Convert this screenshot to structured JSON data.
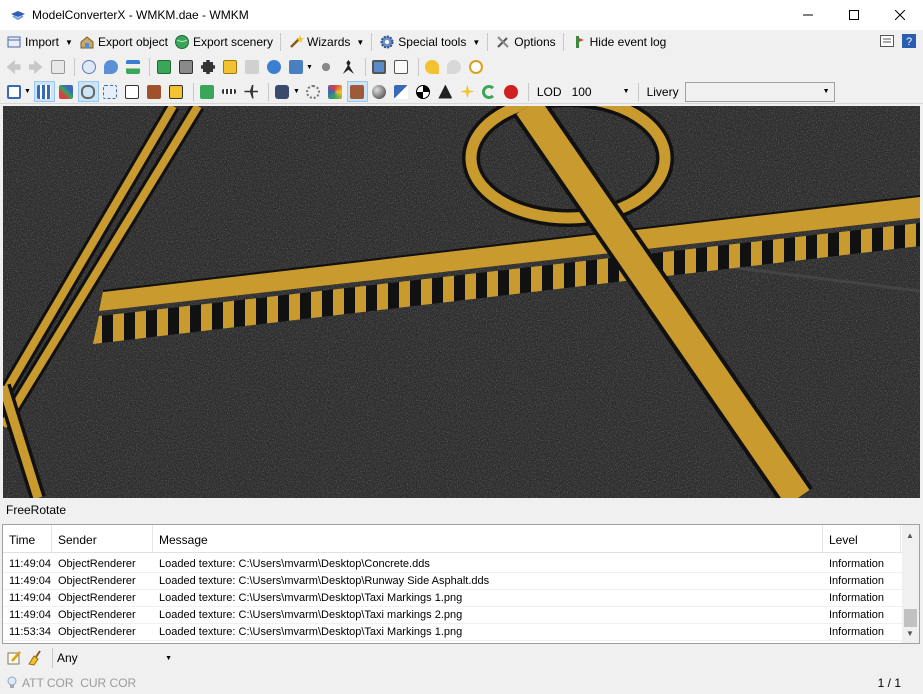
{
  "window": {
    "title": "ModelConverterX - WMKM.dae - WMKM"
  },
  "menu": {
    "import": "Import",
    "export_object": "Export object",
    "export_scenery": "Export scenery",
    "wizards": "Wizards",
    "special_tools": "Special tools",
    "options": "Options",
    "hide_event_log": "Hide event log"
  },
  "toolbar2": {
    "lod_label": "LOD",
    "lod_value": "100",
    "livery_label": "Livery",
    "livery_value": ""
  },
  "viewport": {
    "mode": "FreeRotate"
  },
  "log": {
    "columns": {
      "time": "Time",
      "sender": "Sender",
      "message": "Message",
      "level": "Level"
    },
    "rows": [
      {
        "time": "11:49:04",
        "sender": "ObjectRenderer",
        "message": "Loaded texture: C:\\Users\\mvarm\\Desktop\\Concrete.dds",
        "level": "Information"
      },
      {
        "time": "11:49:04",
        "sender": "ObjectRenderer",
        "message": "Loaded texture: C:\\Users\\mvarm\\Desktop\\Runway Side Asphalt.dds",
        "level": "Information"
      },
      {
        "time": "11:49:04",
        "sender": "ObjectRenderer",
        "message": "Loaded texture: C:\\Users\\mvarm\\Desktop\\Taxi Markings 1.png",
        "level": "Information"
      },
      {
        "time": "11:49:04",
        "sender": "ObjectRenderer",
        "message": "Loaded texture: C:\\Users\\mvarm\\Desktop\\Taxi markings 2.png",
        "level": "Information"
      },
      {
        "time": "11:53:34",
        "sender": "ObjectRenderer",
        "message": "Loaded texture: C:\\Users\\mvarm\\Desktop\\Taxi Markings 1.png",
        "level": "Information"
      }
    ]
  },
  "filter": {
    "level_value": "Any"
  },
  "status": {
    "left": "ATT COR  CUR COR",
    "page": "1 / 1"
  },
  "colors": {
    "marking_yellow": "#c99a2e",
    "asphalt": "#2e2e2e"
  }
}
